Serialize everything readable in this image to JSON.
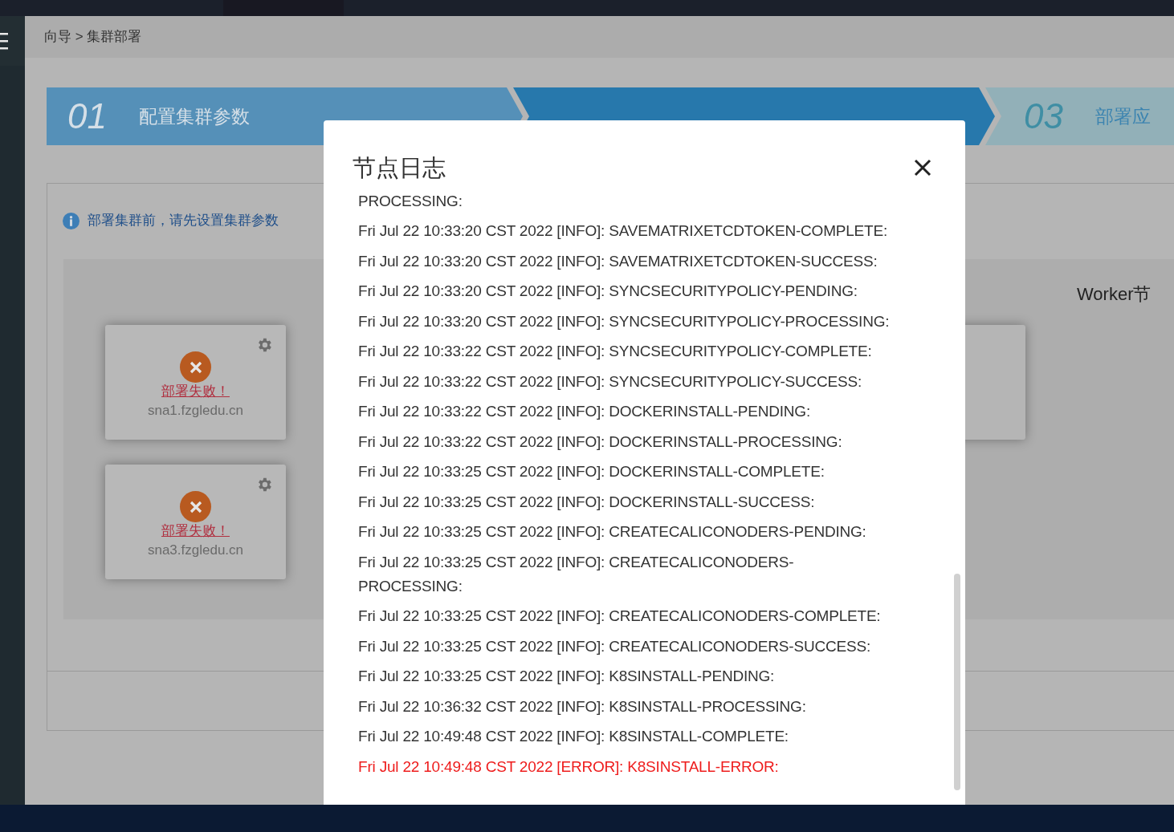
{
  "breadcrumb": "向导 > 集群部署",
  "steps": [
    {
      "number": "01",
      "label": "配置集群参数",
      "selected": false,
      "disabled": false
    },
    {
      "selected": true,
      "disabled": false
    },
    {
      "number": "03",
      "label": "部署应",
      "selected": false,
      "disabled": true
    }
  ],
  "notice": "部署集群前，请先设置集群参数",
  "nodes": [
    {
      "status": "部署失败！",
      "failed": true,
      "host": "sna1.fzgledu.cn"
    },
    {
      "status": "部署失败！",
      "failed": true,
      "host": "sna3.fzgledu.cn"
    }
  ],
  "worker_heading": "Worker节",
  "modal": {
    "title": "节点日志",
    "log": [
      {
        "kind": "info",
        "text": "PROCESSING:"
      },
      {
        "kind": "info",
        "text": "Fri Jul 22 10:33:20 CST 2022 [INFO]: SAVEMATRIXETCDTOKEN-COMPLETE:"
      },
      {
        "kind": "info",
        "text": "Fri Jul 22 10:33:20 CST 2022 [INFO]: SAVEMATRIXETCDTOKEN-SUCCESS:"
      },
      {
        "kind": "info",
        "text": "Fri Jul 22 10:33:20 CST 2022 [INFO]: SYNCSECURITYPOLICY-PENDING:"
      },
      {
        "kind": "info",
        "text": "Fri Jul 22 10:33:20 CST 2022 [INFO]: SYNCSECURITYPOLICY-PROCESSING:"
      },
      {
        "kind": "info",
        "text": "Fri Jul 22 10:33:22 CST 2022 [INFO]: SYNCSECURITYPOLICY-COMPLETE:"
      },
      {
        "kind": "info",
        "text": "Fri Jul 22 10:33:22 CST 2022 [INFO]: SYNCSECURITYPOLICY-SUCCESS:"
      },
      {
        "kind": "info",
        "text": "Fri Jul 22 10:33:22 CST 2022 [INFO]: DOCKERINSTALL-PENDING:"
      },
      {
        "kind": "info",
        "text": "Fri Jul 22 10:33:22 CST 2022 [INFO]: DOCKERINSTALL-PROCESSING:"
      },
      {
        "kind": "info",
        "text": "Fri Jul 22 10:33:25 CST 2022 [INFO]: DOCKERINSTALL-COMPLETE:"
      },
      {
        "kind": "info",
        "text": "Fri Jul 22 10:33:25 CST 2022 [INFO]: DOCKERINSTALL-SUCCESS:"
      },
      {
        "kind": "info",
        "text": "Fri Jul 22 10:33:25 CST 2022 [INFO]: CREATECALICONODERS-PENDING:"
      },
      {
        "kind": "info",
        "text": "Fri Jul 22 10:33:25 CST 2022 [INFO]: CREATECALICONODERS-\nPROCESSING:"
      },
      {
        "kind": "info",
        "text": "Fri Jul 22 10:33:25 CST 2022 [INFO]: CREATECALICONODERS-COMPLETE:"
      },
      {
        "kind": "info",
        "text": "Fri Jul 22 10:33:25 CST 2022 [INFO]: CREATECALICONODERS-SUCCESS:"
      },
      {
        "kind": "info",
        "text": "Fri Jul 22 10:33:25 CST 2022 [INFO]: K8SINSTALL-PENDING:"
      },
      {
        "kind": "info",
        "text": "Fri Jul 22 10:36:32 CST 2022 [INFO]: K8SINSTALL-PROCESSING:"
      },
      {
        "kind": "info",
        "text": "Fri Jul 22 10:49:48 CST 2022 [INFO]: K8SINSTALL-COMPLETE:"
      },
      {
        "kind": "error",
        "text": "Fri Jul 22 10:49:48 CST 2022 [ERROR]: K8SINSTALL-ERROR:"
      }
    ]
  }
}
